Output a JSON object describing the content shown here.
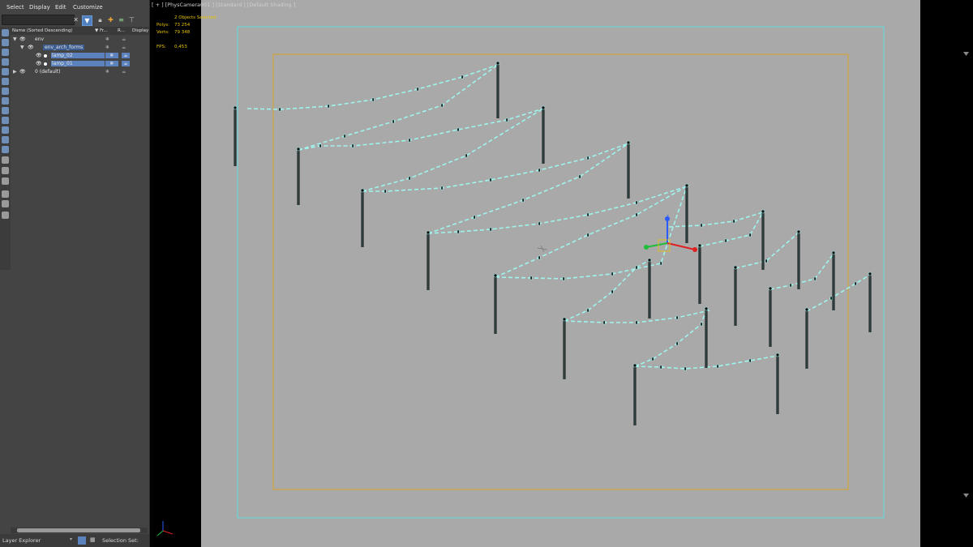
{
  "menu": [
    "Select",
    "Display",
    "Edit",
    "Customize"
  ],
  "search": {
    "value": "",
    "placeholder": ""
  },
  "columns": {
    "name": "Name (Sorted Descending)",
    "frozen": "▼ Fr...",
    "render": "R...",
    "display": "Display"
  },
  "tree": [
    {
      "label": "env",
      "level": 0,
      "selected": false
    },
    {
      "label": "env_arch_forms",
      "level": 1,
      "selected": false
    },
    {
      "label": "lamp_02",
      "level": 2,
      "selected": true
    },
    {
      "label": "lamp_01",
      "level": 2,
      "selected": true
    },
    {
      "label": "0 (default)",
      "level": 0,
      "selected": false
    }
  ],
  "status": {
    "layer_explorer": "Layer Explorer",
    "selection_set": "Selection Set:"
  },
  "viewport": {
    "label": "[ + ] [PhysCamera001 ] [Standard ] [Default Shading ]",
    "selected": "2 Objects Selected",
    "polys_label": "Polys:",
    "polys": "73 254",
    "verts_label": "Verts:",
    "verts": "79 348",
    "fps_label": "FPS:",
    "fps": "0,453"
  },
  "colors": {
    "panel": "#444444",
    "selection": "#5b82bd",
    "viewport_bg": "#a9a9a9",
    "stats": "#e8c400",
    "wire": "#9ff4ee"
  },
  "icons": [
    "close-icon",
    "filter-icon",
    "lock-icon",
    "layer-add-icon",
    "hierarchy-icon",
    "eye-icon",
    "snowflake-icon",
    "teapot-icon"
  ]
}
